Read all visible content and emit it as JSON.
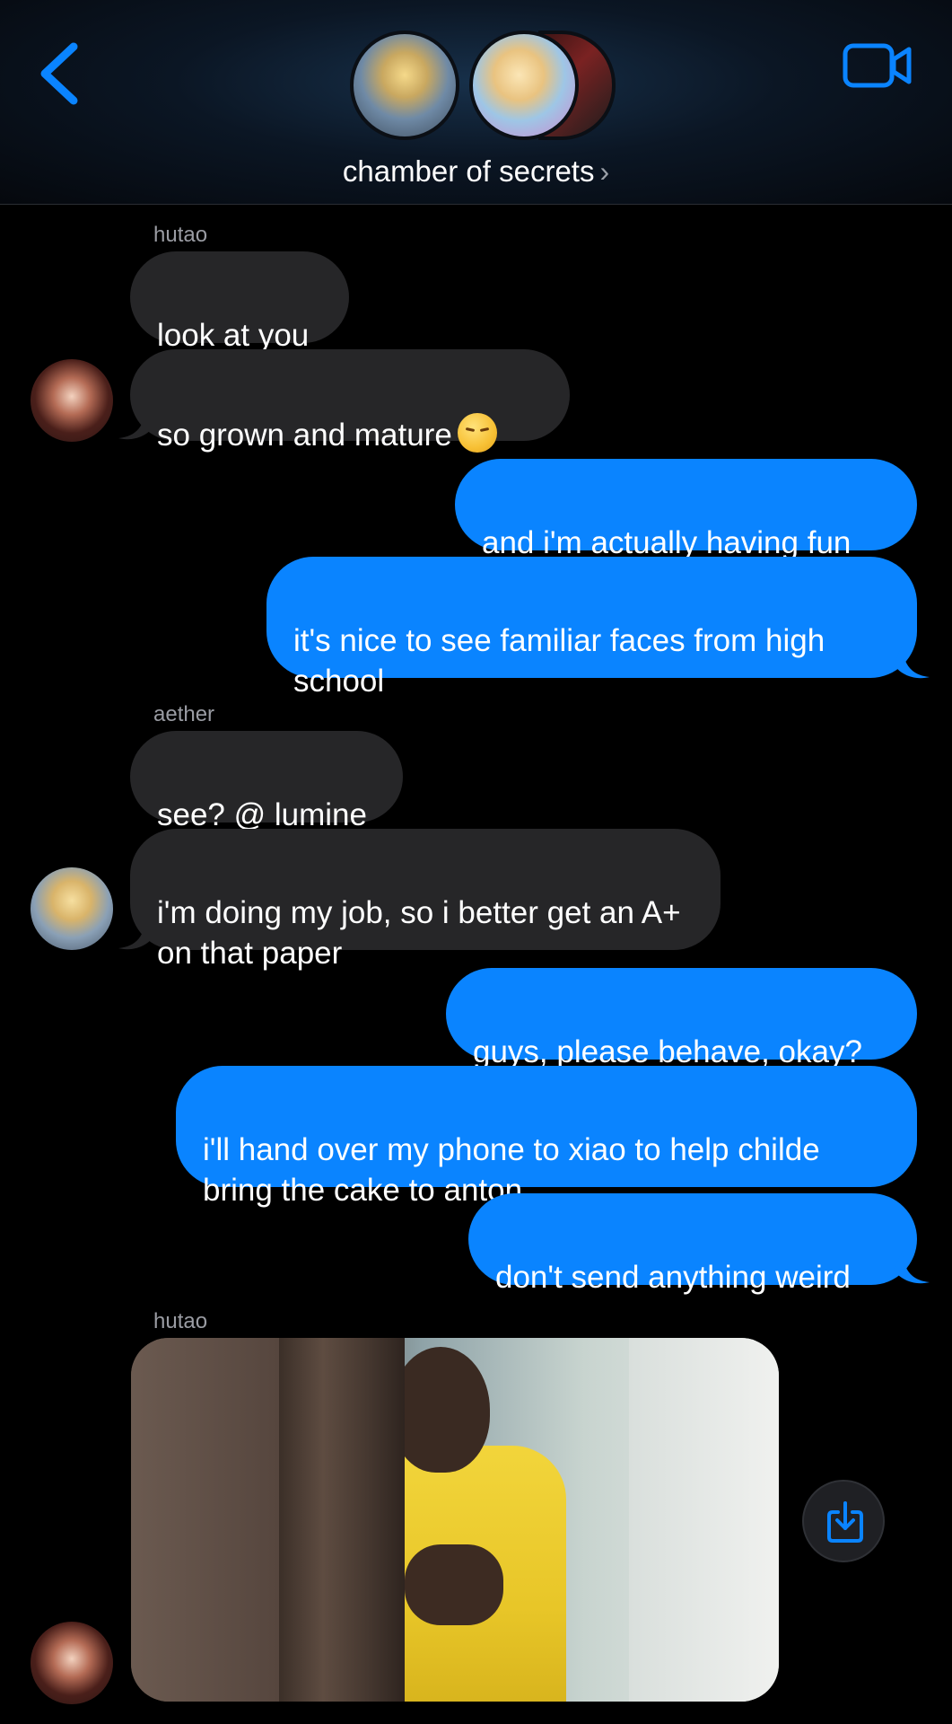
{
  "header": {
    "group_name": "chamber of secrets",
    "chevron": "›",
    "back_icon": "chevron-left-icon",
    "video_icon": "video-camera-icon",
    "accent_color": "#0a84ff"
  },
  "messages": [
    {
      "sender": "hutao",
      "direction": "incoming",
      "text": "look at you"
    },
    {
      "sender": "hutao",
      "direction": "incoming",
      "text": "so grown and mature",
      "emoji": "face-exhaling-emoji"
    },
    {
      "direction": "outgoing",
      "text": "and i'm actually having fun"
    },
    {
      "direction": "outgoing",
      "text": "it's nice to see familiar faces from high school"
    },
    {
      "sender": "aether",
      "direction": "incoming",
      "text": "see? @ lumine"
    },
    {
      "sender": "aether",
      "direction": "incoming",
      "text": "i'm doing my job, so i better get an A+ on that paper"
    },
    {
      "direction": "outgoing",
      "text": "guys, please behave, okay?"
    },
    {
      "direction": "outgoing",
      "text": "i'll hand over my phone to xiao to help childe bring the cake to anton"
    },
    {
      "direction": "outgoing",
      "text": "don't send anything weird"
    },
    {
      "sender": "hutao",
      "direction": "incoming",
      "type": "image"
    }
  ],
  "labels": {
    "hutao_1": "hutao",
    "aether": "aether",
    "hutao_2": "hutao"
  },
  "actions": {
    "save_icon": "save-download-icon"
  },
  "colors": {
    "incoming_bubble": "#262628",
    "outgoing_bubble": "#0a84ff",
    "background": "#000000"
  }
}
